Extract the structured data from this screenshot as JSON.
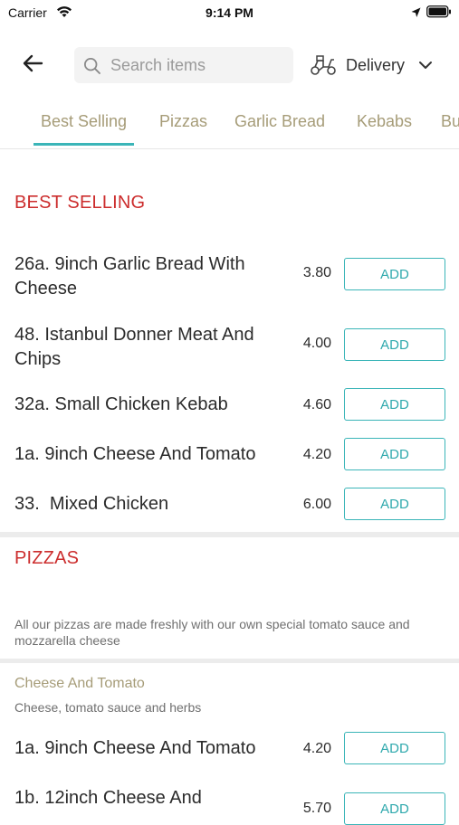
{
  "status_bar": {
    "carrier": "Carrier",
    "time": "9:14 PM"
  },
  "header": {
    "search_placeholder": "Search items",
    "delivery_label": "Delivery"
  },
  "tabs": [
    {
      "label": "Best Selling",
      "active": true
    },
    {
      "label": "Pizzas",
      "active": false
    },
    {
      "label": "Garlic Bread",
      "active": false
    },
    {
      "label": "Kebabs",
      "active": false
    },
    {
      "label": "Bu",
      "active": false
    }
  ],
  "colors": {
    "accent": "#3bb5b8",
    "section_title": "#cc2d2d",
    "tab_text": "#a69c78"
  },
  "best_selling": {
    "title": "BEST SELLING",
    "items": [
      {
        "name": "26a. 9inch Garlic Bread With Cheese",
        "price": "3.80",
        "button": "ADD"
      },
      {
        "name": "48. Istanbul Donner Meat And Chips",
        "price": "4.00",
        "button": "ADD"
      },
      {
        "name": "32a. Small Chicken Kebab",
        "price": "4.60",
        "button": "ADD"
      },
      {
        "name": "1a. 9inch Cheese And Tomato",
        "price": "4.20",
        "button": "ADD"
      },
      {
        "name": "33.  Mixed Chicken",
        "price": "6.00",
        "button": "ADD"
      }
    ]
  },
  "pizzas": {
    "title": "PIZZAS",
    "description": "All our pizzas are made freshly with our own special tomato sauce and mozzarella cheese",
    "subcategory": {
      "title": "Cheese And Tomato",
      "description": "Cheese, tomato sauce and herbs"
    },
    "items": [
      {
        "name": "1a. 9inch Cheese And Tomato",
        "price": "4.20",
        "button": "ADD"
      },
      {
        "name": "1b. 12inch Cheese And",
        "price": "5.70",
        "button": "ADD"
      }
    ]
  }
}
